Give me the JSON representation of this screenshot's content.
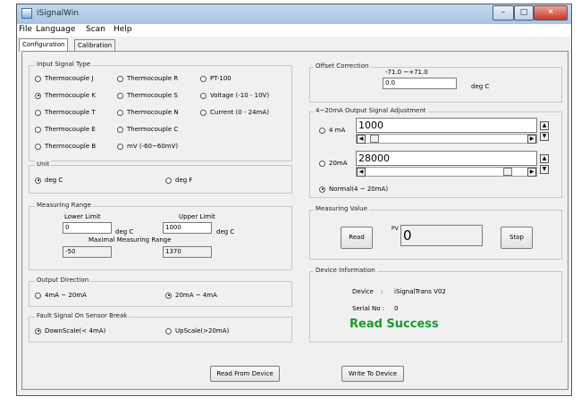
{
  "window": {
    "title": "iSignalWin",
    "caption_buttons": [
      "minimize-icon",
      "maximize-icon",
      "close-icon"
    ]
  },
  "menu": {
    "items": [
      "File",
      "Language",
      "Scan",
      "Help"
    ]
  },
  "tabs": [
    {
      "label": "Configuration",
      "active": true
    },
    {
      "label": "Calibration",
      "active": false
    }
  ],
  "input_signal": {
    "title": "Input Signal Type",
    "options": [
      {
        "label": "Thermocouple J",
        "checked": false
      },
      {
        "label": "Thermocouple R",
        "checked": false
      },
      {
        "label": "PT-100",
        "checked": false
      },
      {
        "label": "Thermocouple K",
        "checked": true
      },
      {
        "label": "Thermocouple S",
        "checked": false
      },
      {
        "label": "Voltage (-10 - 10V)",
        "checked": false
      },
      {
        "label": "Thermocouple T",
        "checked": false
      },
      {
        "label": "Thermocouple N",
        "checked": false
      },
      {
        "label": "Current (0 - 24mA)",
        "checked": false
      },
      {
        "label": "Thermocouple E",
        "checked": false
      },
      {
        "label": "Thermocouple C",
        "checked": false
      },
      {
        "label": "Thermocouple B",
        "checked": false
      },
      {
        "label": "mV (-60~60mV)",
        "checked": false
      }
    ]
  },
  "unit": {
    "title": "Unit",
    "options": [
      {
        "label": "deg C",
        "checked": true
      },
      {
        "label": "deg F",
        "checked": false
      }
    ]
  },
  "measuring_range": {
    "title": "Measuring Range",
    "lower_label": "Lower Limit",
    "upper_label": "Upper Limit",
    "lower_value": "0",
    "upper_value": "1000",
    "unit_a": "deg C",
    "unit_b": "deg C",
    "max_label": "Maximal Measuring Range",
    "max_low": "-50",
    "max_high": "1370"
  },
  "output_direction": {
    "title": "Output Direction",
    "options": [
      {
        "label": "4mA ~ 20mA",
        "checked": false
      },
      {
        "label": "20mA ~ 4mA",
        "checked": true
      }
    ]
  },
  "fault_signal": {
    "title": "Fault Signal On Sensor Break",
    "options": [
      {
        "label": "DownScale(< 4mA)",
        "checked": true
      },
      {
        "label": "UpScale(>20mA)",
        "checked": false
      }
    ]
  },
  "offset": {
    "title": "Offset Correction",
    "range": "-71.0  ~+71.0",
    "value": "0.0",
    "unit": "deg C"
  },
  "adjust": {
    "title": "4~20mA Output Signal Adjustment",
    "ma4": {
      "label": "4 mA",
      "value": "1000",
      "checked": false,
      "slider_level": 0.03
    },
    "ma20": {
      "label": "20mA",
      "value": "28000",
      "checked": false,
      "slider_level": 0.9
    },
    "normal": {
      "label": "Normal(4 ~ 20mA)",
      "checked": true
    }
  },
  "measuring": {
    "title": "Measuring Value",
    "read": "Read",
    "pv": "PV",
    "value": "0",
    "stop": "Stop"
  },
  "device": {
    "title": "Device Information",
    "device_label": "Device",
    "sep": ":",
    "device_value": "iSignalTrans  V02",
    "serial_label": "Serial No :",
    "serial_value": "0",
    "status": "Read Success",
    "status_color": "#1a9a2a"
  },
  "buttons": {
    "read_device": "Read From Device",
    "write_device": "Write To Device"
  }
}
